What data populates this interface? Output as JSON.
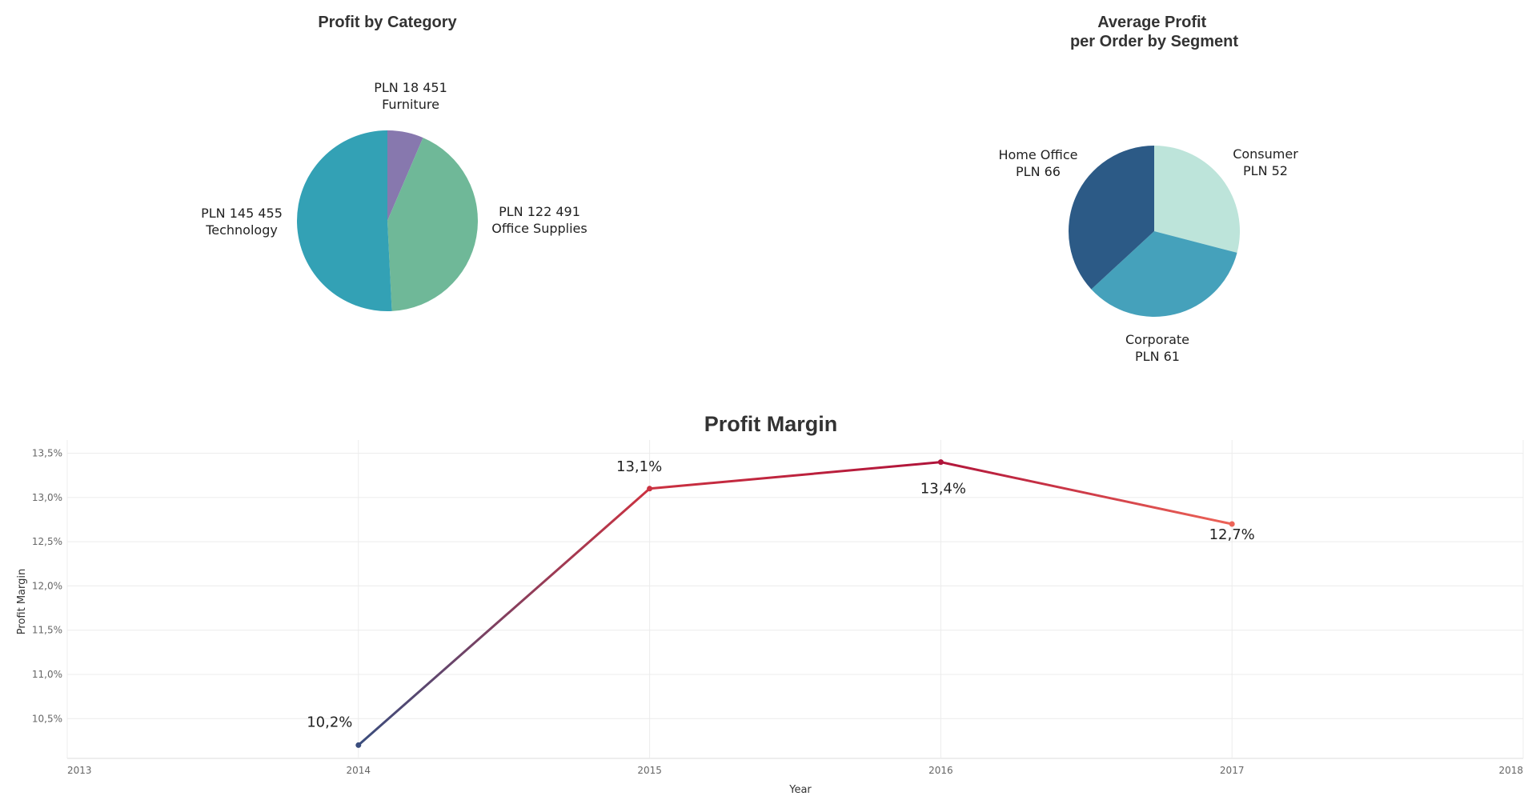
{
  "chart_data": [
    {
      "type": "pie",
      "title": "Profit by Category",
      "slices": [
        {
          "label": "Furniture",
          "value": 18451,
          "display": "PLN 18 451",
          "color": "#8778ae"
        },
        {
          "label": "Office Supplies",
          "value": 122491,
          "display": "PLN 122 491",
          "color": "#6fb898"
        },
        {
          "label": "Technology",
          "value": 145455,
          "display": "PLN 145 455",
          "color": "#33a1b5"
        }
      ]
    },
    {
      "type": "pie",
      "title": [
        "Average Profit",
        "per Order by Segment"
      ],
      "slices": [
        {
          "label": "Consumer",
          "value": 52,
          "display": "PLN 52",
          "color": "#bde4da"
        },
        {
          "label": "Corporate",
          "value": 61,
          "display": "PLN 61",
          "color": "#45a1bb"
        },
        {
          "label": "Home Office",
          "value": 66,
          "display": "PLN 66",
          "color": "#2c5a86"
        }
      ]
    },
    {
      "type": "line",
      "title": "Profit Margin",
      "xlabel": "Year",
      "ylabel": "Profit Margin",
      "x": [
        2014,
        2015,
        2016,
        2017
      ],
      "values": [
        10.2,
        13.1,
        13.4,
        12.7
      ],
      "point_labels": [
        "10,2%",
        "13,1%",
        "13,4%",
        "12,7%"
      ],
      "point_colors": [
        "#3a4d7d",
        "#cb3241",
        "#b0143a",
        "#ec6357"
      ],
      "xlim": [
        2013,
        2018
      ],
      "ylim": [
        10.05,
        13.65
      ],
      "xticks": [
        "2013",
        "2014",
        "2015",
        "2016",
        "2017",
        "2018"
      ],
      "yticks": [
        {
          "value": 10.5,
          "label": "10,5%"
        },
        {
          "value": 11.0,
          "label": "11,0%"
        },
        {
          "value": 11.5,
          "label": "11,5%"
        },
        {
          "value": 12.0,
          "label": "12,0%"
        },
        {
          "value": 12.5,
          "label": "12,5%"
        },
        {
          "value": 13.0,
          "label": "13,0%"
        },
        {
          "value": 13.5,
          "label": "13,5%"
        }
      ],
      "grid": true
    }
  ]
}
